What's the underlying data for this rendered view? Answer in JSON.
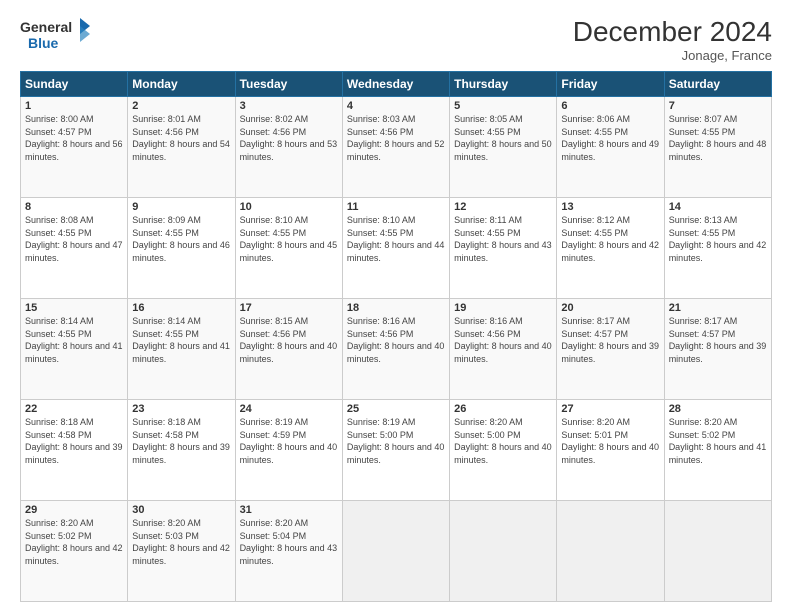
{
  "header": {
    "logo_line1": "General",
    "logo_line2": "Blue",
    "month_title": "December 2024",
    "subtitle": "Jonage, France"
  },
  "weekdays": [
    "Sunday",
    "Monday",
    "Tuesday",
    "Wednesday",
    "Thursday",
    "Friday",
    "Saturday"
  ],
  "weeks": [
    [
      {
        "day": "1",
        "sunrise": "8:00 AM",
        "sunset": "4:57 PM",
        "daylight": "8 hours and 56 minutes."
      },
      {
        "day": "2",
        "sunrise": "8:01 AM",
        "sunset": "4:56 PM",
        "daylight": "8 hours and 54 minutes."
      },
      {
        "day": "3",
        "sunrise": "8:02 AM",
        "sunset": "4:56 PM",
        "daylight": "8 hours and 53 minutes."
      },
      {
        "day": "4",
        "sunrise": "8:03 AM",
        "sunset": "4:56 PM",
        "daylight": "8 hours and 52 minutes."
      },
      {
        "day": "5",
        "sunrise": "8:05 AM",
        "sunset": "4:55 PM",
        "daylight": "8 hours and 50 minutes."
      },
      {
        "day": "6",
        "sunrise": "8:06 AM",
        "sunset": "4:55 PM",
        "daylight": "8 hours and 49 minutes."
      },
      {
        "day": "7",
        "sunrise": "8:07 AM",
        "sunset": "4:55 PM",
        "daylight": "8 hours and 48 minutes."
      }
    ],
    [
      {
        "day": "8",
        "sunrise": "8:08 AM",
        "sunset": "4:55 PM",
        "daylight": "8 hours and 47 minutes."
      },
      {
        "day": "9",
        "sunrise": "8:09 AM",
        "sunset": "4:55 PM",
        "daylight": "8 hours and 46 minutes."
      },
      {
        "day": "10",
        "sunrise": "8:10 AM",
        "sunset": "4:55 PM",
        "daylight": "8 hours and 45 minutes."
      },
      {
        "day": "11",
        "sunrise": "8:10 AM",
        "sunset": "4:55 PM",
        "daylight": "8 hours and 44 minutes."
      },
      {
        "day": "12",
        "sunrise": "8:11 AM",
        "sunset": "4:55 PM",
        "daylight": "8 hours and 43 minutes."
      },
      {
        "day": "13",
        "sunrise": "8:12 AM",
        "sunset": "4:55 PM",
        "daylight": "8 hours and 42 minutes."
      },
      {
        "day": "14",
        "sunrise": "8:13 AM",
        "sunset": "4:55 PM",
        "daylight": "8 hours and 42 minutes."
      }
    ],
    [
      {
        "day": "15",
        "sunrise": "8:14 AM",
        "sunset": "4:55 PM",
        "daylight": "8 hours and 41 minutes."
      },
      {
        "day": "16",
        "sunrise": "8:14 AM",
        "sunset": "4:55 PM",
        "daylight": "8 hours and 41 minutes."
      },
      {
        "day": "17",
        "sunrise": "8:15 AM",
        "sunset": "4:56 PM",
        "daylight": "8 hours and 40 minutes."
      },
      {
        "day": "18",
        "sunrise": "8:16 AM",
        "sunset": "4:56 PM",
        "daylight": "8 hours and 40 minutes."
      },
      {
        "day": "19",
        "sunrise": "8:16 AM",
        "sunset": "4:56 PM",
        "daylight": "8 hours and 40 minutes."
      },
      {
        "day": "20",
        "sunrise": "8:17 AM",
        "sunset": "4:57 PM",
        "daylight": "8 hours and 39 minutes."
      },
      {
        "day": "21",
        "sunrise": "8:17 AM",
        "sunset": "4:57 PM",
        "daylight": "8 hours and 39 minutes."
      }
    ],
    [
      {
        "day": "22",
        "sunrise": "8:18 AM",
        "sunset": "4:58 PM",
        "daylight": "8 hours and 39 minutes."
      },
      {
        "day": "23",
        "sunrise": "8:18 AM",
        "sunset": "4:58 PM",
        "daylight": "8 hours and 39 minutes."
      },
      {
        "day": "24",
        "sunrise": "8:19 AM",
        "sunset": "4:59 PM",
        "daylight": "8 hours and 40 minutes."
      },
      {
        "day": "25",
        "sunrise": "8:19 AM",
        "sunset": "5:00 PM",
        "daylight": "8 hours and 40 minutes."
      },
      {
        "day": "26",
        "sunrise": "8:20 AM",
        "sunset": "5:00 PM",
        "daylight": "8 hours and 40 minutes."
      },
      {
        "day": "27",
        "sunrise": "8:20 AM",
        "sunset": "5:01 PM",
        "daylight": "8 hours and 40 minutes."
      },
      {
        "day": "28",
        "sunrise": "8:20 AM",
        "sunset": "5:02 PM",
        "daylight": "8 hours and 41 minutes."
      }
    ],
    [
      {
        "day": "29",
        "sunrise": "8:20 AM",
        "sunset": "5:02 PM",
        "daylight": "8 hours and 42 minutes."
      },
      {
        "day": "30",
        "sunrise": "8:20 AM",
        "sunset": "5:03 PM",
        "daylight": "8 hours and 42 minutes."
      },
      {
        "day": "31",
        "sunrise": "8:20 AM",
        "sunset": "5:04 PM",
        "daylight": "8 hours and 43 minutes."
      },
      null,
      null,
      null,
      null
    ]
  ],
  "labels": {
    "sunrise": "Sunrise:",
    "sunset": "Sunset:",
    "daylight": "Daylight:"
  }
}
